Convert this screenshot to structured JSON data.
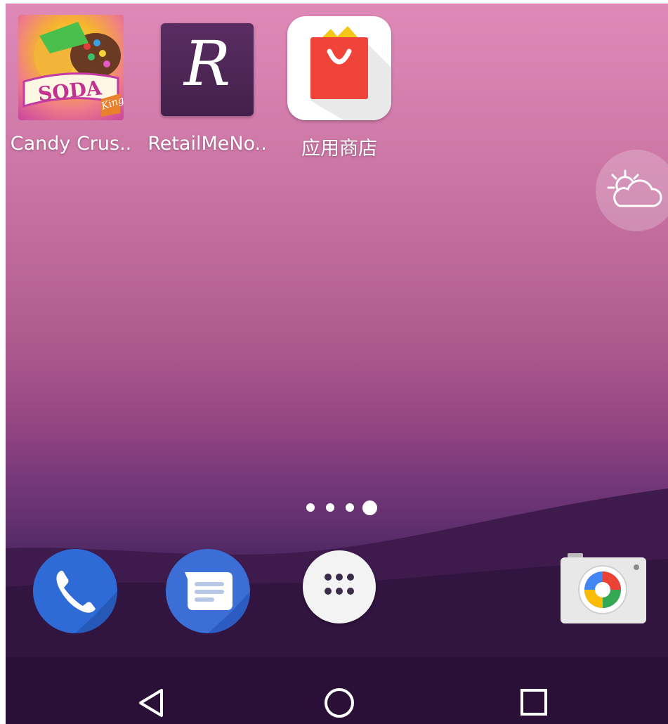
{
  "home_screen": {
    "apps": [
      {
        "label": "Candy Crus..",
        "icon": "candy-crush-soda-icon"
      },
      {
        "label": "RetailMeNo..",
        "icon": "retailmenot-icon"
      },
      {
        "label": "应用商店",
        "icon": "app-store-bag-icon"
      }
    ],
    "weather_widget": {
      "icon": "partly-cloudy-icon"
    },
    "page_indicator": {
      "pages": 4,
      "current_page": 4
    },
    "candy_logo_text": "SODA",
    "candy_brand_text": "King",
    "retail_logo_letter": "R"
  },
  "dock": {
    "items": [
      {
        "name": "Phone",
        "icon": "phone-icon"
      },
      {
        "name": "Messages",
        "icon": "messages-icon"
      },
      {
        "name": "All apps",
        "icon": "app-drawer-icon"
      },
      {
        "name": "Camera",
        "icon": "camera-icon"
      }
    ]
  },
  "nav_bar": {
    "buttons": [
      "back",
      "home",
      "recents"
    ]
  },
  "colors": {
    "wallpaper_top": "#de89b7",
    "wallpaper_bottom": "#2b0f36",
    "store_bag_red": "#f0433a",
    "phone_blue": "#2f6bd6",
    "messages_blue": "#3b6fd6"
  }
}
